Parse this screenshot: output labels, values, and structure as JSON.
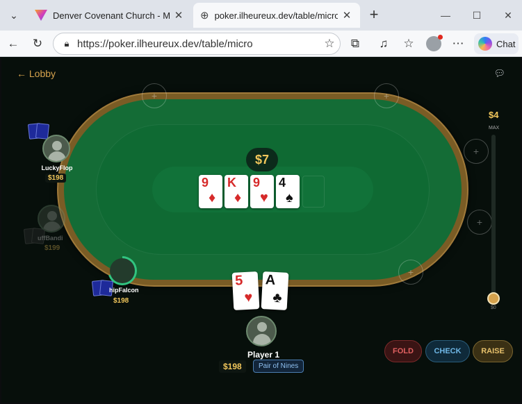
{
  "browser": {
    "tabs": [
      {
        "label": "Denver Covenant Church - Manage",
        "icon": "brand-v-icon"
      },
      {
        "label": "poker.ilheureux.dev/table/micro",
        "icon": "globe-icon"
      }
    ],
    "url": "https://poker.ilheureux.dev/table/micro",
    "chat_label": "Chat"
  },
  "game": {
    "lobby_label": "← Lobby",
    "pot": "$7",
    "board": [
      {
        "rank": "9",
        "suit": "♦",
        "color": "red"
      },
      {
        "rank": "K",
        "suit": "♦",
        "color": "red"
      },
      {
        "rank": "9",
        "suit": "♥",
        "color": "red"
      },
      {
        "rank": "4",
        "suit": "♠",
        "color": "black"
      }
    ],
    "players": [
      {
        "name": "LuckyFlop",
        "stack": "$198"
      },
      {
        "name": "uffBandi",
        "stack": "$199"
      },
      {
        "name": "hipFalcon",
        "stack": "$198"
      }
    ],
    "hero": {
      "name": "Player 1",
      "stack": "$198",
      "hand_label": "Pair of Nines",
      "cards": [
        {
          "rank": "5",
          "suit": "♥",
          "color": "red"
        },
        {
          "rank": "A",
          "suit": "♣",
          "color": "black"
        }
      ]
    },
    "bet": {
      "max_value": "$4",
      "max_label": "MAX",
      "min_label": "$0"
    },
    "actions": {
      "fold": "FOLD",
      "check": "CHECK",
      "raise": "RAISE"
    },
    "empty_seat_symbol": "+"
  },
  "colors": {
    "felt": "#146c36",
    "rail": "#7a5c25",
    "gold": "#f1c65b"
  }
}
